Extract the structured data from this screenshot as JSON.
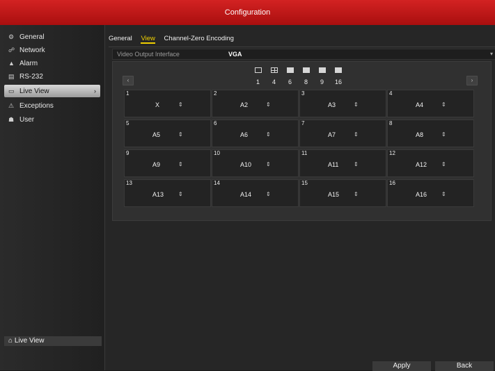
{
  "title": "Configuration",
  "sidebar": {
    "items": [
      {
        "label": "General",
        "icon": "gear-icon"
      },
      {
        "label": "Network",
        "icon": "network-icon"
      },
      {
        "label": "Alarm",
        "icon": "alarm-icon"
      },
      {
        "label": "RS-232",
        "icon": "serial-port-icon"
      },
      {
        "label": "Live View",
        "icon": "monitor-icon",
        "active": true
      },
      {
        "label": "Exceptions",
        "icon": "warning-icon"
      },
      {
        "label": "User",
        "icon": "user-icon"
      }
    ],
    "bottom_label": "Live View"
  },
  "tabs": [
    {
      "label": "General"
    },
    {
      "label": "View",
      "active": true
    },
    {
      "label": "Channel-Zero Encoding"
    }
  ],
  "video_output": {
    "label": "Video Output Interface",
    "value": "VGA"
  },
  "layouts": [
    "1",
    "4",
    "6",
    "8",
    "9",
    "16"
  ],
  "cells": [
    {
      "num": "1",
      "value": "X"
    },
    {
      "num": "2",
      "value": "A2"
    },
    {
      "num": "3",
      "value": "A3"
    },
    {
      "num": "4",
      "value": "A4"
    },
    {
      "num": "5",
      "value": "A5"
    },
    {
      "num": "6",
      "value": "A6"
    },
    {
      "num": "7",
      "value": "A7"
    },
    {
      "num": "8",
      "value": "A8"
    },
    {
      "num": "9",
      "value": "A9"
    },
    {
      "num": "10",
      "value": "A10"
    },
    {
      "num": "11",
      "value": "A11"
    },
    {
      "num": "12",
      "value": "A12"
    },
    {
      "num": "13",
      "value": "A13"
    },
    {
      "num": "14",
      "value": "A14"
    },
    {
      "num": "15",
      "value": "A15"
    },
    {
      "num": "16",
      "value": "A16"
    }
  ],
  "buttons": {
    "apply": "Apply",
    "back": "Back"
  },
  "colors": {
    "titlebar": "#c41a1a",
    "active_tab": "#f0d000"
  }
}
